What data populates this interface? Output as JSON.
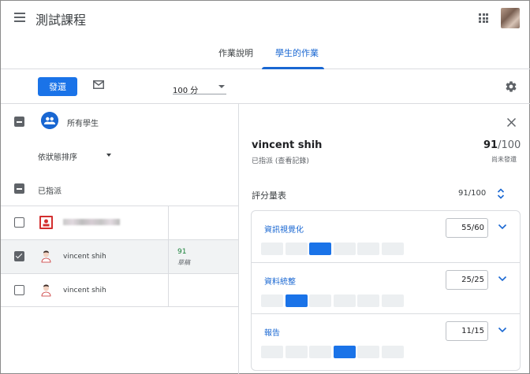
{
  "header": {
    "course_title": "測試課程"
  },
  "tabs": [
    {
      "label": "作業說明"
    },
    {
      "label": "學生的作業",
      "active": true
    }
  ],
  "toolbar": {
    "return_label": "發還",
    "points_value": "100 分"
  },
  "left": {
    "all_students_label": "所有學生",
    "sort_label": "依狀態排序",
    "assigned_label": "已指派",
    "rows": [
      {
        "name": "",
        "grade": "",
        "status": "",
        "selected": false,
        "checked": false
      },
      {
        "name": "vincent shih",
        "grade": "91",
        "status": "草稿",
        "selected": true,
        "checked": true
      },
      {
        "name": "vincent shih",
        "grade": "",
        "status": "",
        "selected": false,
        "checked": false
      }
    ]
  },
  "detail": {
    "student_name": "vincent shih",
    "assigned_note": "已指派 (查看記錄)",
    "score": "91",
    "score_den": "/100",
    "return_status": "尚未發還",
    "rubric_title": "評分量表",
    "rubric_score": "91/100",
    "criteria": [
      {
        "name": "資訊視覺化",
        "score": "55/60",
        "levels": 6,
        "selected_level": 2
      },
      {
        "name": "資料統整",
        "score": "25/25",
        "levels": 6,
        "selected_level": 1
      },
      {
        "name": "報告",
        "score": "11/15",
        "levels": 6,
        "selected_level": 3
      }
    ]
  },
  "colors": {
    "accent": "#1a73e8",
    "grade_green": "#188038"
  }
}
